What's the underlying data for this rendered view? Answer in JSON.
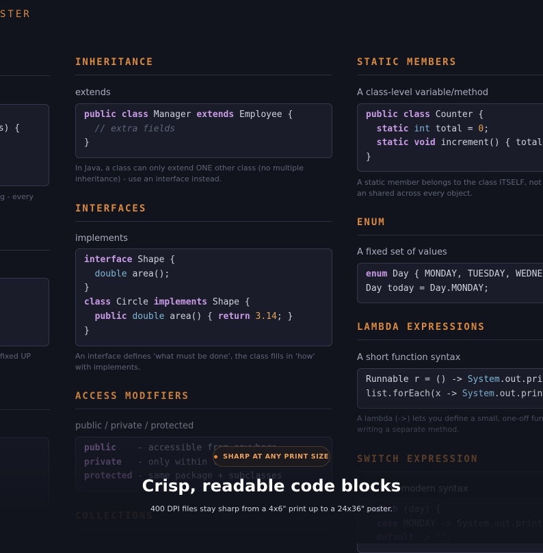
{
  "poster_title": "STER",
  "left": {
    "code_line": "gs) {",
    "note1": "g - every",
    "note2": "fixed UP"
  },
  "middle": {
    "inheritance": {
      "title": "INHERITANCE",
      "sub": "extends",
      "note": "In Java, a class can only extend ONE other class (no multiple inheritance) - use an interface instead."
    },
    "interfaces": {
      "title": "INTERFACES",
      "sub": "implements",
      "note": "An interface defines 'what must be done', the class fills in 'how' with implements."
    },
    "access": {
      "title": "ACCESS MODIFIERS",
      "sub": "public / private / protected"
    },
    "collections": {
      "title": "COLLECTIONS"
    }
  },
  "right": {
    "static": {
      "title": "STATIC MEMBERS",
      "sub": "A class-level variable/method",
      "note": "A static member belongs to the class ITSELF, not to an shared across every object."
    },
    "enum": {
      "title": "ENUM",
      "sub": "A fixed set of values"
    },
    "lambda": {
      "title": "LAMBDA EXPRESSIONS",
      "sub": "A short function syntax",
      "note": "A lambda (->) lets you define a small, one-off function writing a separate method."
    },
    "switch": {
      "title": "SWITCH EXPRESSION",
      "sub": "nd modern syntax"
    }
  },
  "overlay": {
    "badge": "SHARP AT ANY PRINT SIZE",
    "headline": "Crisp, readable code blocks",
    "subline": "400 DPI files stay sharp from a 4x6\" print up to a 24x36\" poster."
  },
  "colors": {
    "accent": "#d98a42",
    "background": "#11131d",
    "code_bg": "#1a1d29"
  }
}
